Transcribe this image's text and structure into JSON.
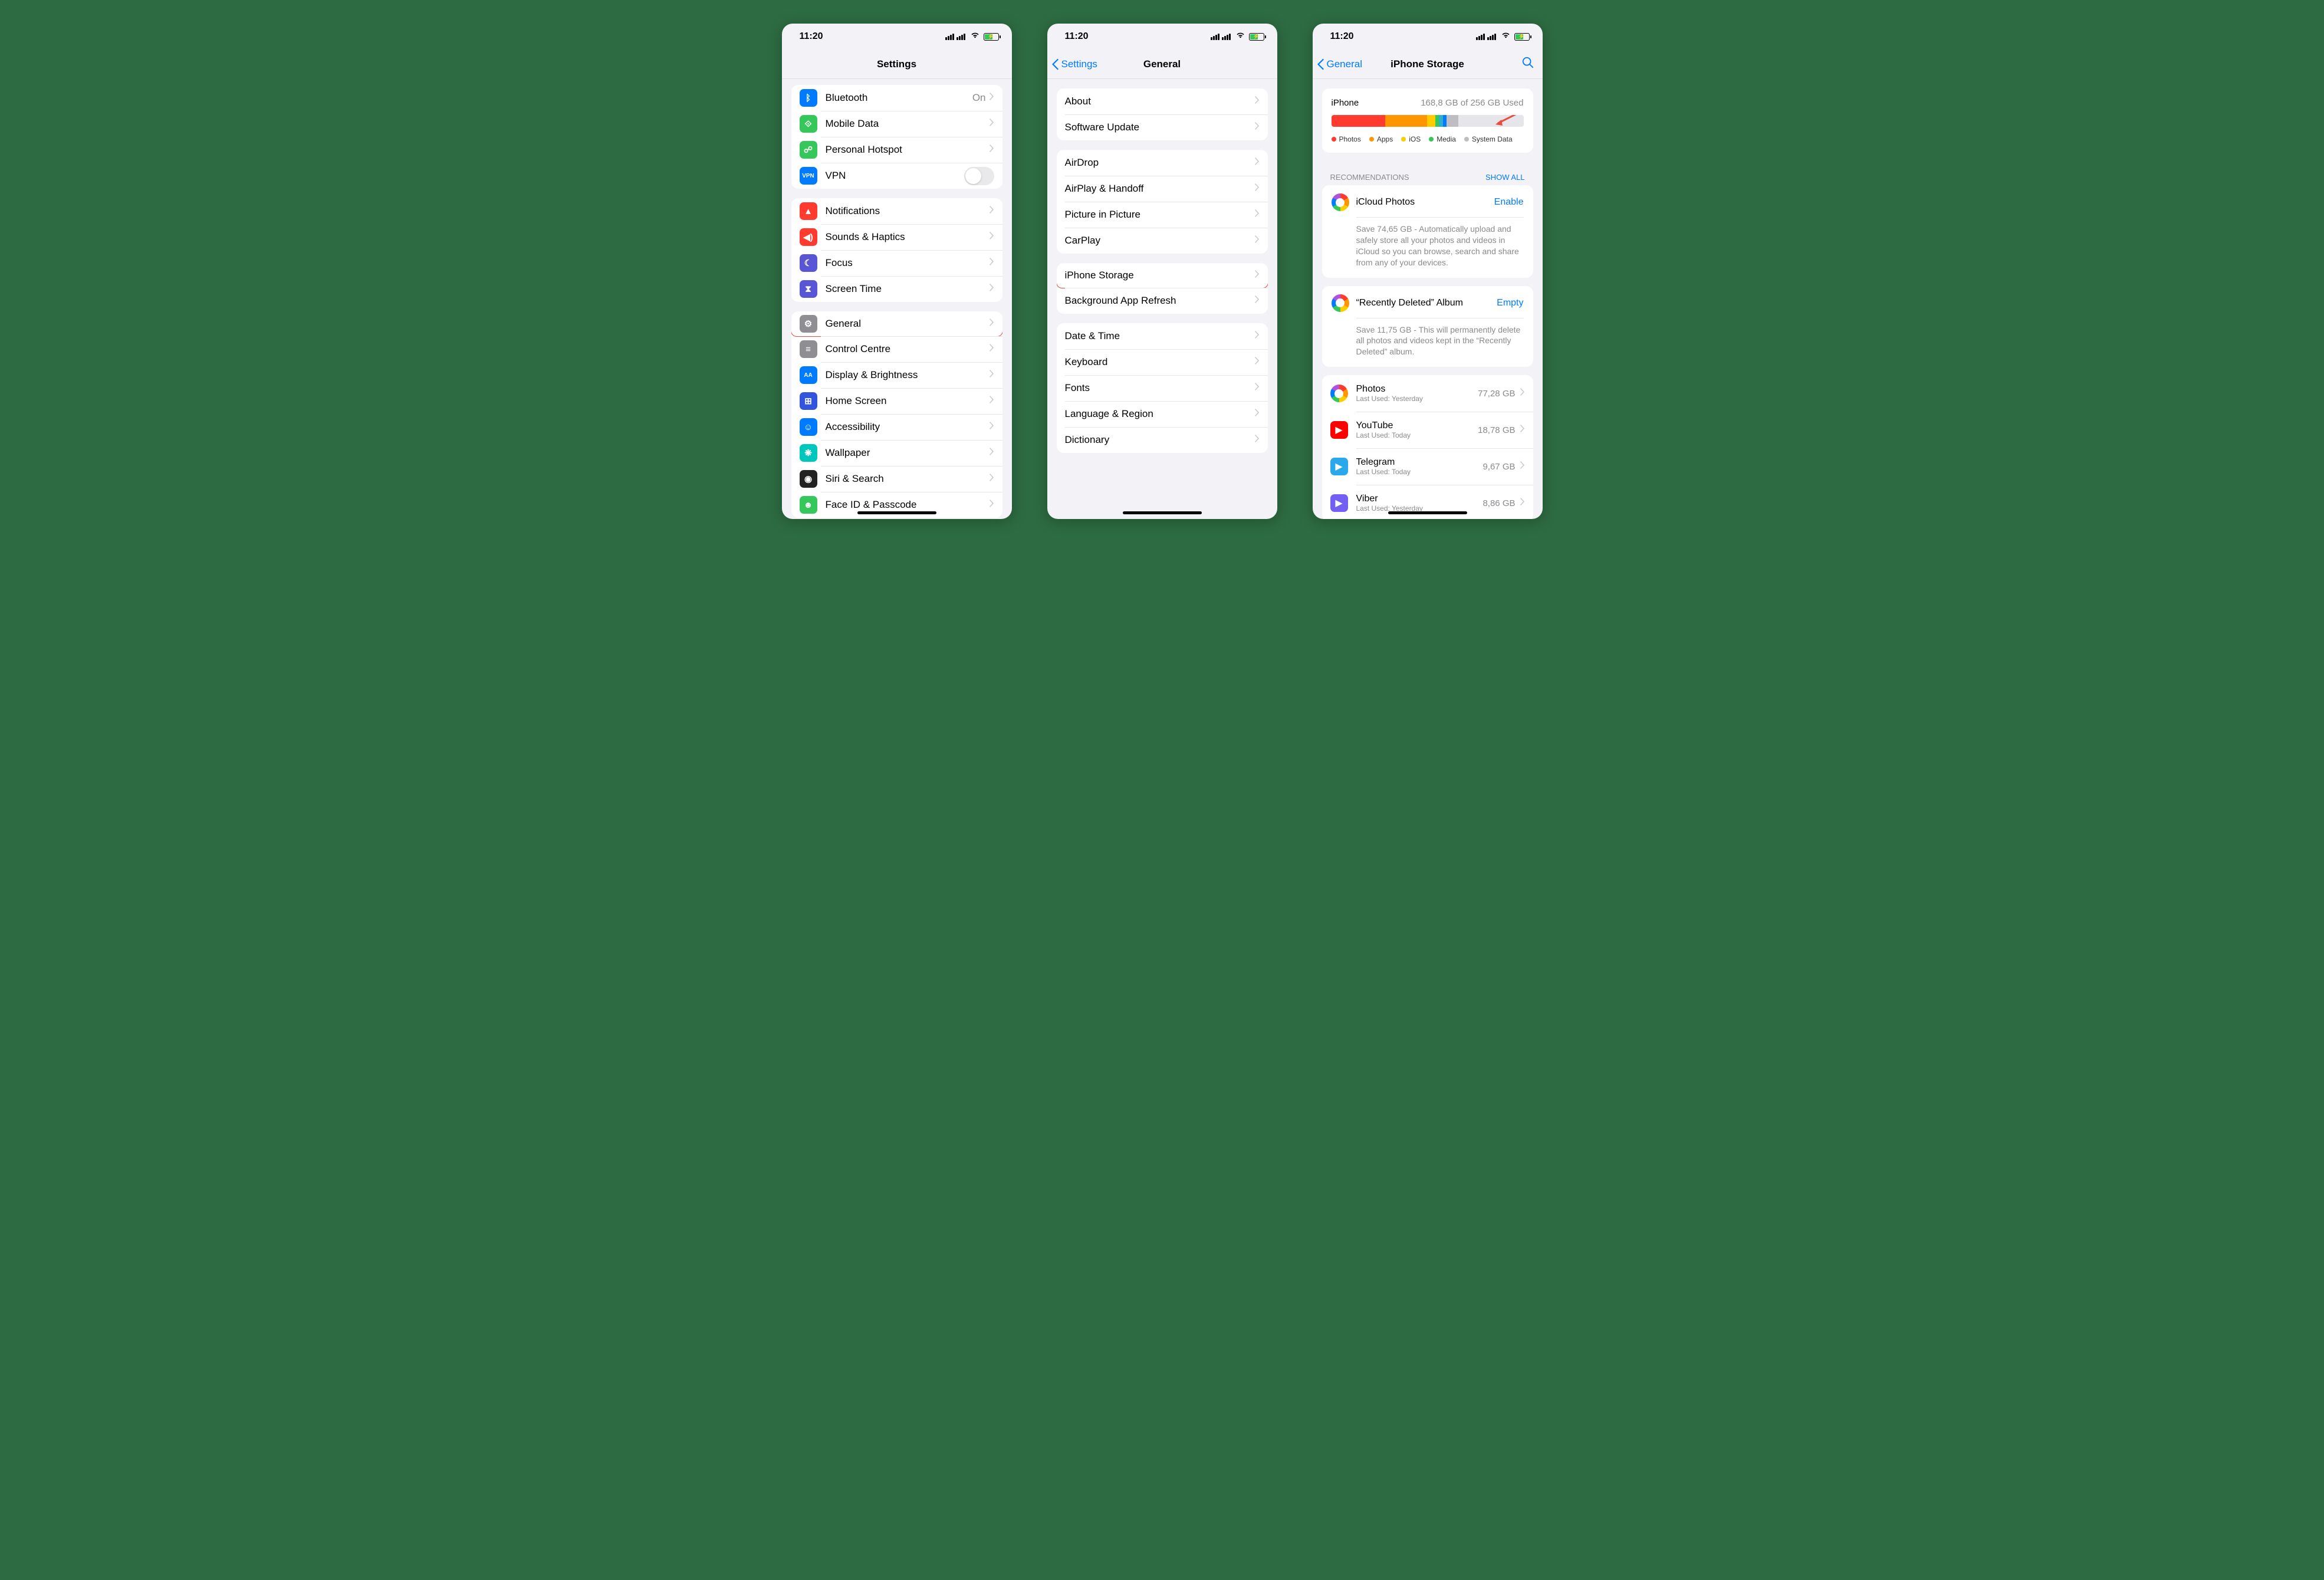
{
  "status": {
    "time": "11:20"
  },
  "s1": {
    "title": "Settings",
    "rows1": [
      {
        "label": "Bluetooth",
        "value": "On",
        "color": "#007aff",
        "icon": "bt"
      },
      {
        "label": "Mobile Data",
        "value": "",
        "color": "#34c759",
        "icon": "ant"
      },
      {
        "label": "Personal Hotspot",
        "value": "",
        "color": "#34c759",
        "icon": "link"
      },
      {
        "label": "VPN",
        "value": "",
        "color": "#007aff",
        "icon": "vpn",
        "toggle": true
      }
    ],
    "rows2": [
      {
        "label": "Notifications",
        "color": "#ff3b30",
        "icon": "bell"
      },
      {
        "label": "Sounds & Haptics",
        "color": "#ff3b30",
        "icon": "spk"
      },
      {
        "label": "Focus",
        "color": "#5856d6",
        "icon": "moon"
      },
      {
        "label": "Screen Time",
        "color": "#5856d6",
        "icon": "hour"
      }
    ],
    "rows3": [
      {
        "label": "General",
        "color": "#8e8e93",
        "icon": "gear",
        "hl": true
      },
      {
        "label": "Control Centre",
        "color": "#8e8e93",
        "icon": "cc"
      },
      {
        "label": "Display & Brightness",
        "color": "#007aff",
        "icon": "AA"
      },
      {
        "label": "Home Screen",
        "color": "#3355dd",
        "icon": "grid"
      },
      {
        "label": "Accessibility",
        "color": "#007aff",
        "icon": "acc"
      },
      {
        "label": "Wallpaper",
        "color": "#00c7be",
        "icon": "wall"
      },
      {
        "label": "Siri & Search",
        "color": "#222",
        "icon": "siri"
      },
      {
        "label": "Face ID & Passcode",
        "color": "#34c759",
        "icon": "face"
      }
    ]
  },
  "s2": {
    "back": "Settings",
    "title": "General",
    "g1": [
      {
        "label": "About"
      },
      {
        "label": "Software Update"
      }
    ],
    "g2": [
      {
        "label": "AirDrop"
      },
      {
        "label": "AirPlay & Handoff"
      },
      {
        "label": "Picture in Picture"
      },
      {
        "label": "CarPlay"
      }
    ],
    "g3": [
      {
        "label": "iPhone Storage",
        "hl": true
      },
      {
        "label": "Background App Refresh"
      }
    ],
    "g4": [
      {
        "label": "Date & Time"
      },
      {
        "label": "Keyboard"
      },
      {
        "label": "Fonts"
      },
      {
        "label": "Language & Region"
      },
      {
        "label": "Dictionary"
      }
    ]
  },
  "s3": {
    "back": "General",
    "title": "iPhone Storage",
    "deviceLabel": "iPhone",
    "usage": "168,8 GB of 256 GB Used",
    "segments": [
      {
        "color": "#ff3b30",
        "pct": 28
      },
      {
        "color": "#ff9500",
        "pct": 22
      },
      {
        "color": "#ffcc00",
        "pct": 4
      },
      {
        "color": "#34c759",
        "pct": 2
      },
      {
        "color": "#30b0c7",
        "pct": 2
      },
      {
        "color": "#007aff",
        "pct": 2
      },
      {
        "color": "#bdbdc2",
        "pct": 6
      }
    ],
    "legend": [
      {
        "label": "Photos",
        "color": "#ff3b30"
      },
      {
        "label": "Apps",
        "color": "#ff9500"
      },
      {
        "label": "iOS",
        "color": "#ffcc00"
      },
      {
        "label": "Media",
        "color": "#34c759"
      },
      {
        "label": "System Data",
        "color": "#bdbdc2"
      }
    ],
    "recHeader": "RECOMMENDATIONS",
    "recLink": "SHOW ALL",
    "recs": [
      {
        "title": "iCloud Photos",
        "action": "Enable",
        "desc": "Save 74,65 GB - Automatically upload and safely store all your photos and videos in iCloud so you can browse, search and share from any of your devices."
      },
      {
        "title": "“Recently Deleted” Album",
        "action": "Empty",
        "desc": "Save 11,75 GB - This will permanently delete all photos and videos kept in the “Recently Deleted” album."
      }
    ],
    "apps": [
      {
        "name": "Photos",
        "sub": "Last Used: Yesterday",
        "size": "77,28 GB",
        "color": "flower"
      },
      {
        "name": "YouTube",
        "sub": "Last Used: Today",
        "size": "18,78 GB",
        "color": "#ff0000"
      },
      {
        "name": "Telegram",
        "sub": "Last Used: Today",
        "size": "9,67 GB",
        "color": "#29a9eb"
      },
      {
        "name": "Viber",
        "sub": "Last Used: Yesterday",
        "size": "8,86 GB",
        "color": "#7360f2"
      }
    ]
  }
}
